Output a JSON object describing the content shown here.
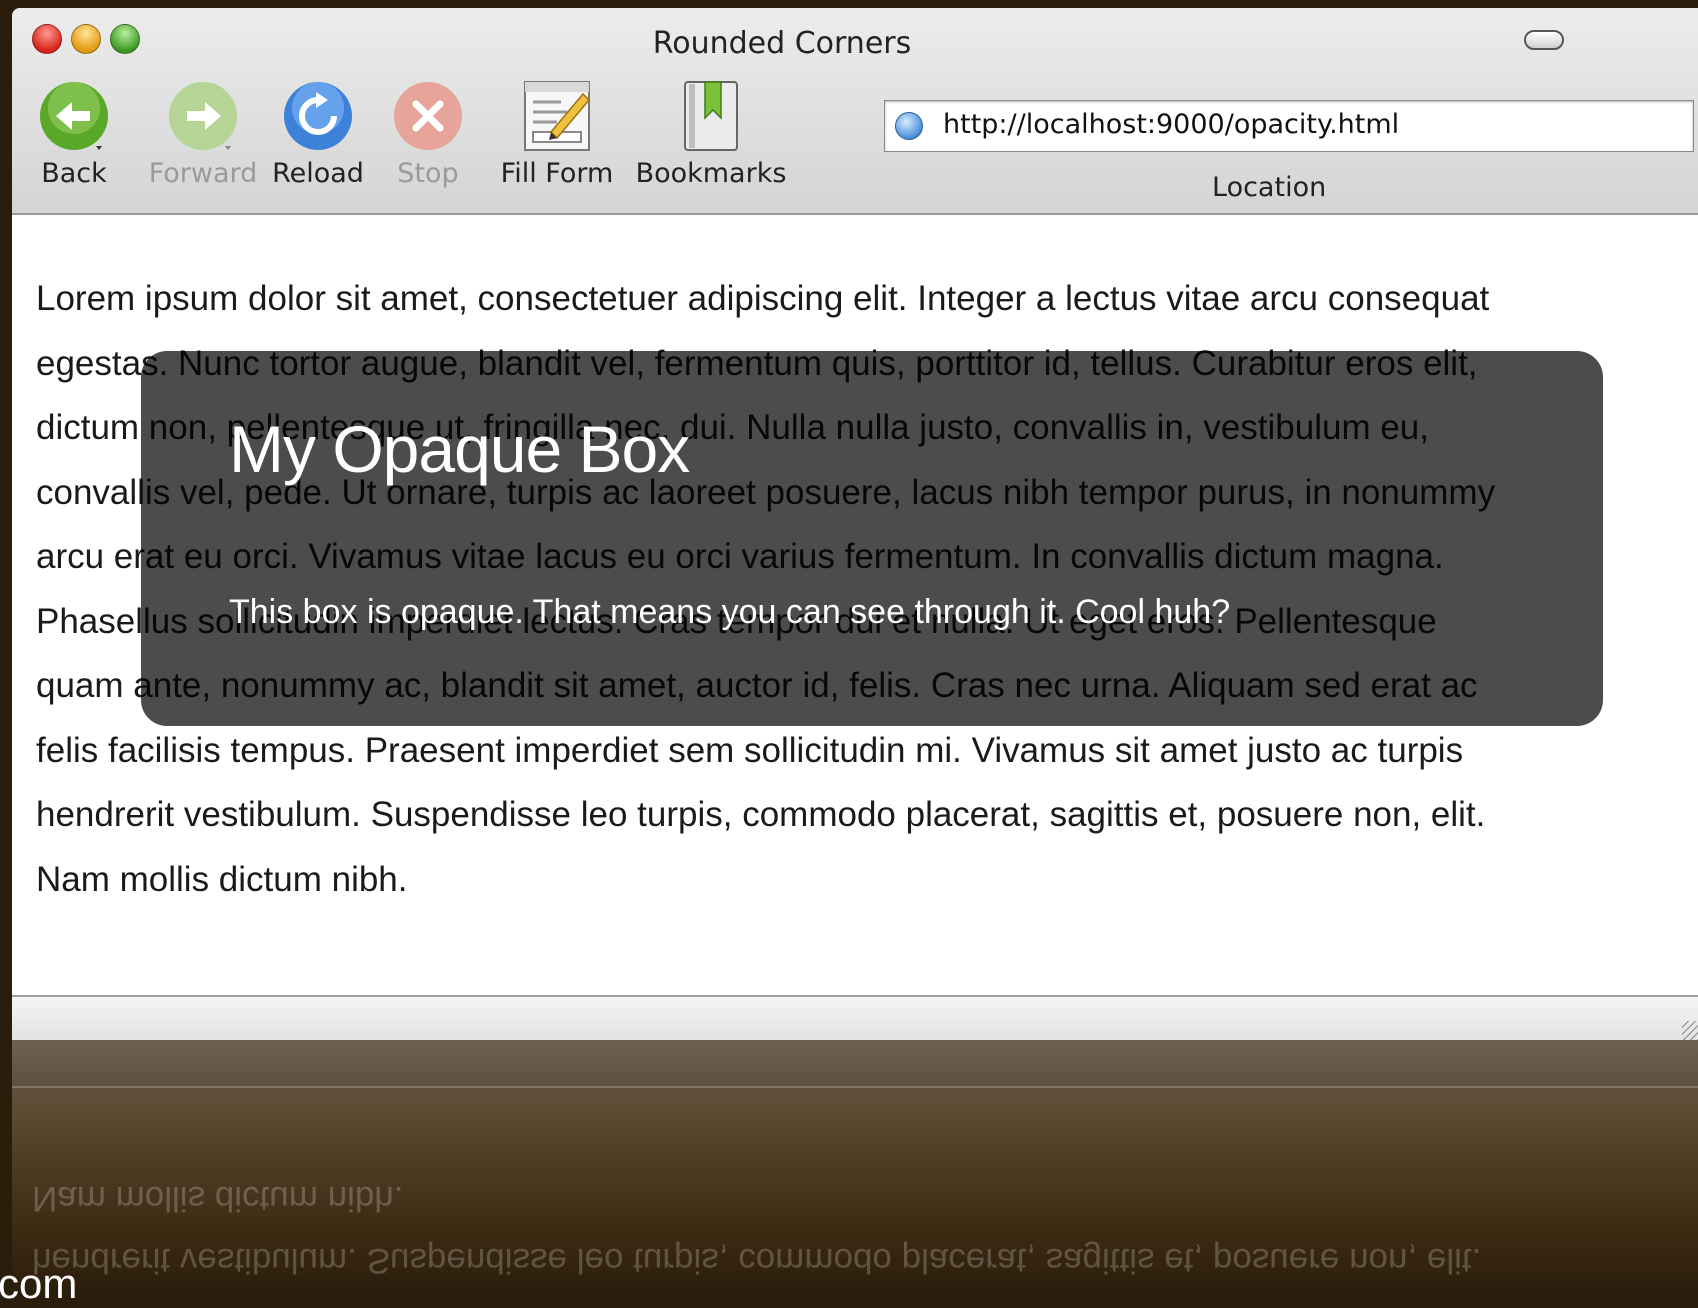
{
  "window": {
    "title": "Rounded Corners"
  },
  "toolbar": {
    "back_label": "Back",
    "forward_label": "Forward",
    "reload_label": "Reload",
    "stop_label": "Stop",
    "fill_form_label": "Fill Form",
    "bookmarks_label": "Bookmarks"
  },
  "location": {
    "url": "http://localhost:9000/opacity.html",
    "label": "Location"
  },
  "page": {
    "body_text": "Lorem ipsum dolor sit amet, consectetuer adipiscing elit. Integer a lectus vitae arcu consequat\negestas. Nunc tortor augue, blandit vel, fermentum quis, porttitor id, tellus. Curabitur eros elit,\ndictum non, pellentesque ut, fringilla nec, dui. Nulla nulla justo, convallis in, vestibulum eu,\nconvallis vel, pede. Ut ornare, turpis ac laoreet posuere, lacus nibh tempor purus, in nonummy\narcu erat eu orci. Vivamus vitae lacus eu orci varius fermentum. In convallis dictum magna.\nPhasellus sollicitudin imperdiet lectus. Cras tempor dui et nulla. Ut eget eros. Pellentesque\nquam ante, nonummy ac, blandit sit amet, auctor id, felis. Cras nec urna. Aliquam sed erat ac\nfelis facilisis tempus. Praesent imperdiet sem sollicitudin mi. Vivamus sit amet justo ac turpis\nhendrerit vestibulum. Suspendisse leo turpis, commodo placerat, sagittis et, posuere non, elit.\nNam mollis dictum nibh.",
    "box_title": "My Opaque Box",
    "box_text": "This box is opaque. That means you can see through it. Cool huh?"
  },
  "reflection": {
    "line1": "Nam mollis dictum nibh.",
    "line2": "hendrerit vestibulum. Suspendisse leo turpis, commodo placerat, sagittis et, posuere non, elit."
  },
  "corner_text": "com",
  "icons": {
    "back": "back-arrow-icon",
    "forward": "forward-arrow-icon",
    "reload": "reload-icon",
    "stop": "stop-icon",
    "fill_form": "fill-form-icon",
    "bookmarks": "bookmarks-icon",
    "url": "globe-icon"
  },
  "colors": {
    "back": "#5aa82a",
    "forward": "#b5d495",
    "reload": "#3d82d8",
    "stop": "#e6a49a",
    "box_background": "rgba(0,0,0,0.7)"
  }
}
